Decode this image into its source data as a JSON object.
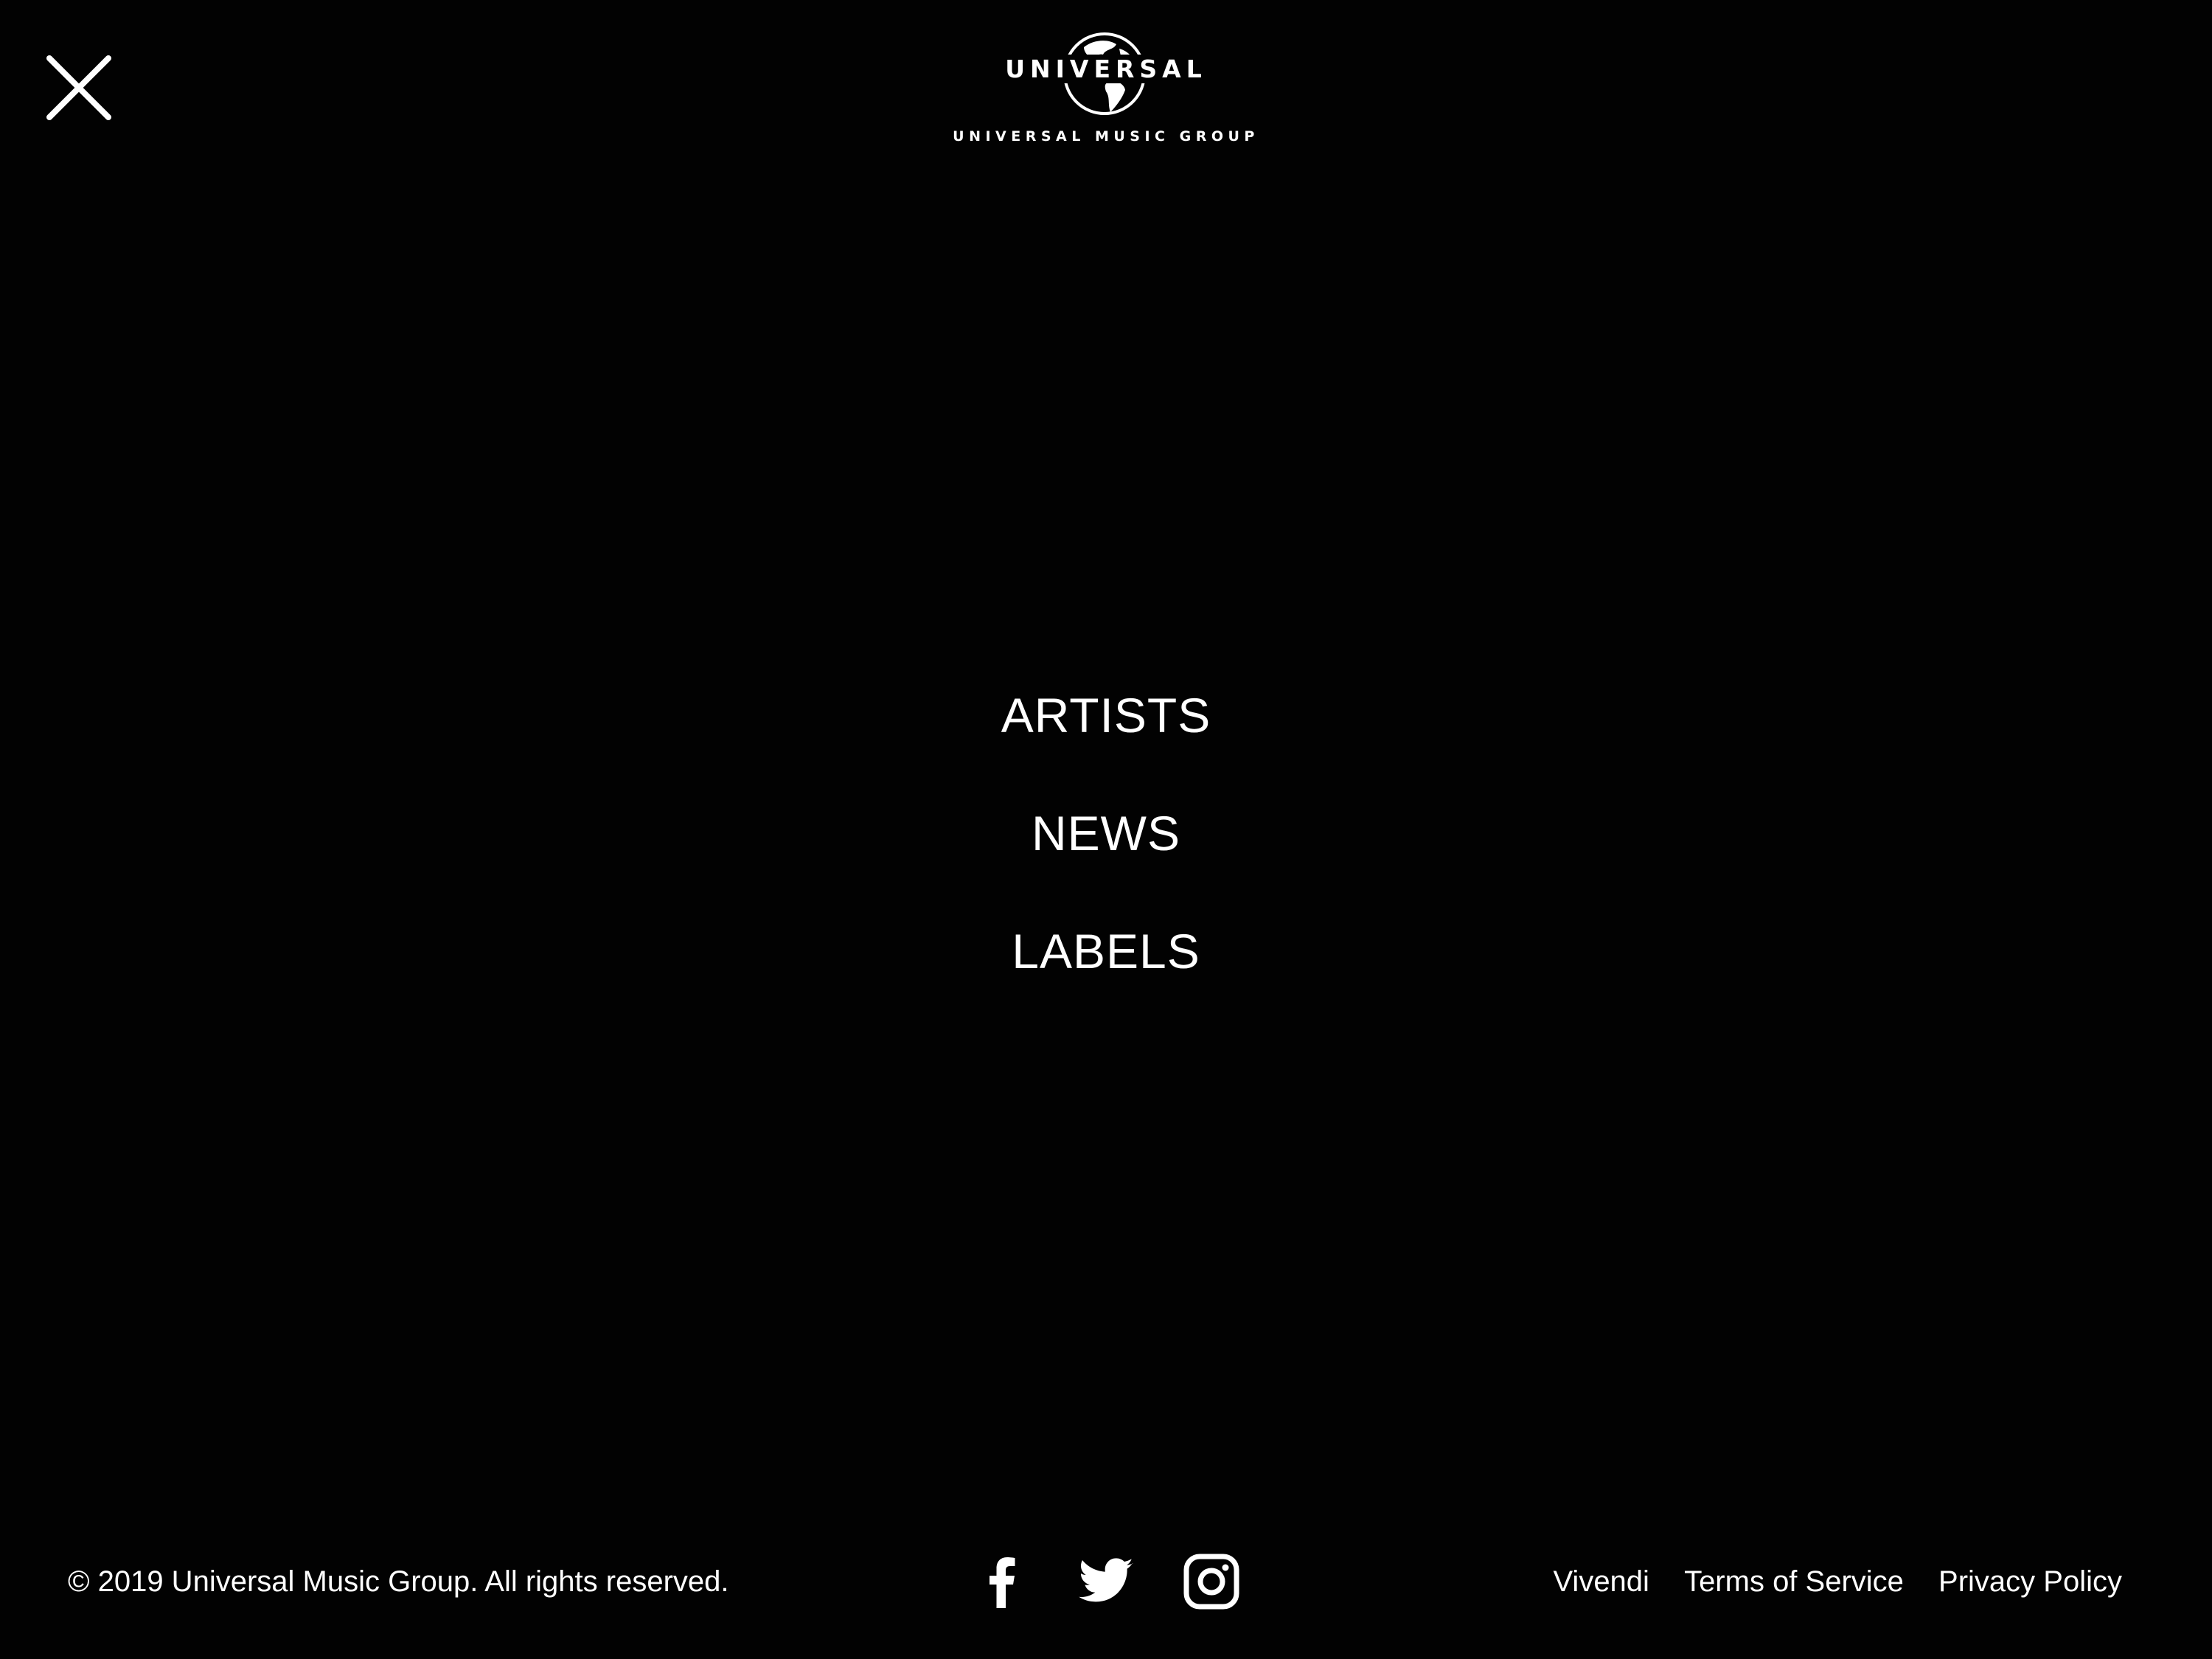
{
  "header": {
    "close_icon": "close-icon",
    "logo": {
      "wordmark": "UNIVERSAL",
      "subline": "UNIVERSAL MUSIC GROUP",
      "icon": "globe-icon"
    }
  },
  "nav": {
    "items": [
      {
        "label": "ARTISTS"
      },
      {
        "label": "NEWS"
      },
      {
        "label": "LABELS"
      }
    ]
  },
  "footer": {
    "copyright": "© 2019 Universal Music Group. All rights reserved.",
    "social": [
      {
        "name": "facebook",
        "icon": "facebook-icon"
      },
      {
        "name": "twitter",
        "icon": "twitter-icon"
      },
      {
        "name": "instagram",
        "icon": "instagram-icon"
      }
    ],
    "links": [
      {
        "label": "Vivendi"
      },
      {
        "label": "Terms of Service"
      },
      {
        "label": "Privacy Policy"
      }
    ]
  },
  "colors": {
    "background": "#020202",
    "text": "#ffffff"
  }
}
